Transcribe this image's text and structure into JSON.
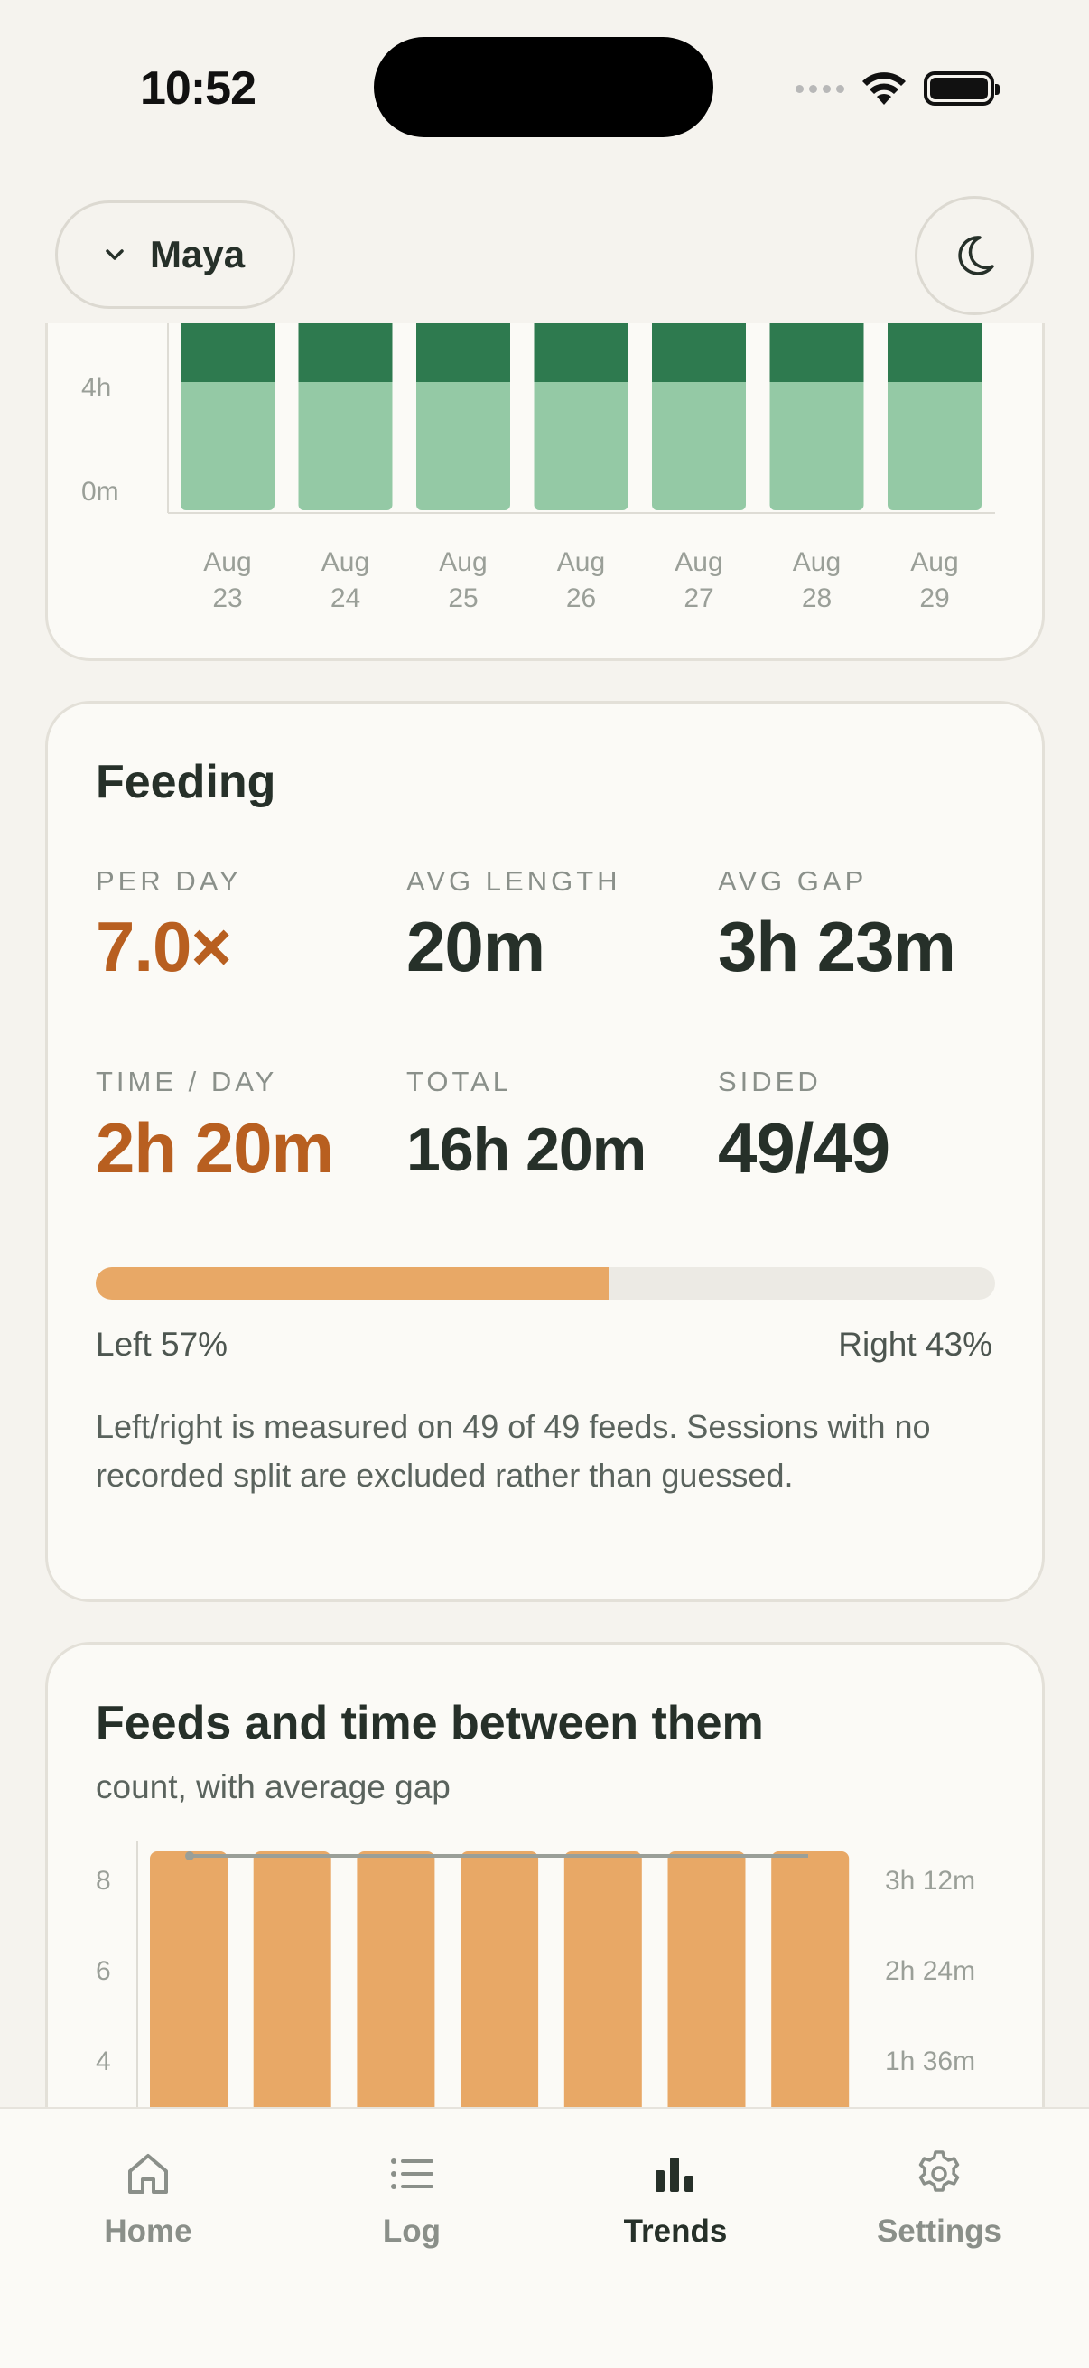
{
  "status": {
    "time": "10:52"
  },
  "header": {
    "child_name": "Maya"
  },
  "sleep_chart": {
    "y_ticks": [
      "4h",
      "0m"
    ],
    "days": [
      {
        "month": "Aug",
        "day": "23"
      },
      {
        "month": "Aug",
        "day": "24"
      },
      {
        "month": "Aug",
        "day": "25"
      },
      {
        "month": "Aug",
        "day": "26"
      },
      {
        "month": "Aug",
        "day": "27"
      },
      {
        "month": "Aug",
        "day": "28"
      },
      {
        "month": "Aug",
        "day": "29"
      }
    ],
    "colors": {
      "dark": "#2E7A4F",
      "light": "#94C9A5"
    }
  },
  "feeding": {
    "title": "Feeding",
    "stats": [
      {
        "label": "PER DAY",
        "value": "7.0×",
        "accent": true
      },
      {
        "label": "AVG LENGTH",
        "value": "20m",
        "accent": false
      },
      {
        "label": "AVG GAP",
        "value": "3h 23m",
        "accent": false
      },
      {
        "label": "TIME / DAY",
        "value": "2h 20m",
        "accent": true
      },
      {
        "label": "TOTAL",
        "value": "16h 20m",
        "accent": false
      },
      {
        "label": "SIDED",
        "value": "49/49",
        "accent": false
      }
    ],
    "left_fraction": 0.57,
    "left_label": "Left 57%",
    "right_label": "Right 43%",
    "note": "Left/right is measured on 49 of 49 feeds. Sessions with no recorded split are excluded rather than guessed.",
    "accent_color": "#B85F20",
    "bar_color": "#E8A866"
  },
  "feeds_chart": {
    "title": "Feeds and time between them",
    "subtitle": "count, with average gap"
  },
  "chart_data": [
    {
      "type": "bar",
      "categories": [
        "Aug 23",
        "Aug 24",
        "Aug 25",
        "Aug 26",
        "Aug 27",
        "Aug 28",
        "Aug 29"
      ],
      "ylabel": "",
      "y_ticks": [
        "0m",
        "4h"
      ]
    },
    {
      "type": "bar",
      "title": "Feeds and time between them",
      "subtitle": "count, with average gap",
      "series": [
        {
          "values": [
            7,
            7,
            7,
            7,
            7,
            7,
            7
          ]
        }
      ],
      "line_values": [
        7,
        7,
        7,
        7,
        7,
        7,
        7
      ],
      "left_ticks": [
        4,
        6,
        8
      ],
      "right_ticks": [
        "1h 36m",
        "2h 24m",
        "3h 12m"
      ],
      "ylim": [
        0,
        8
      ]
    }
  ],
  "tabs": [
    {
      "label": "Home",
      "icon": "house-icon",
      "active": false
    },
    {
      "label": "Log",
      "icon": "list-icon",
      "active": false
    },
    {
      "label": "Trends",
      "icon": "bar-chart-icon",
      "active": true
    },
    {
      "label": "Settings",
      "icon": "gear-icon",
      "active": false
    }
  ]
}
